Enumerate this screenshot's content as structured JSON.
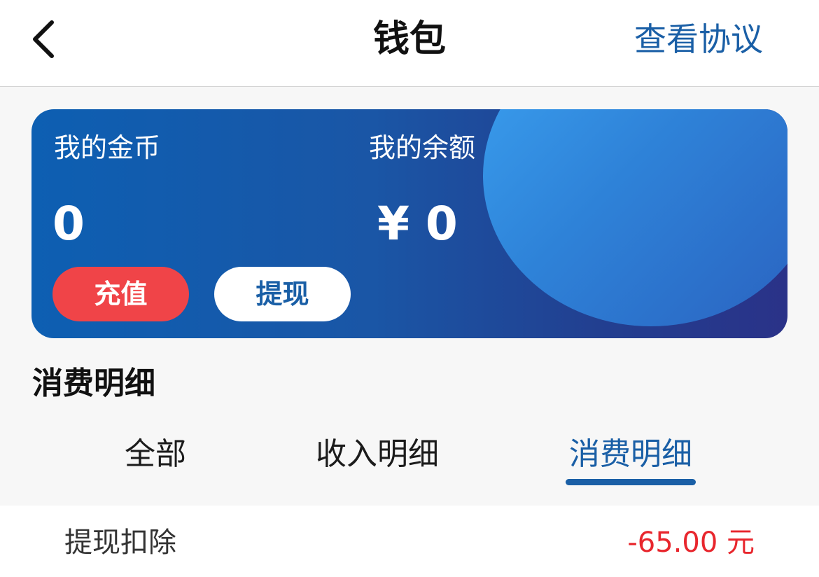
{
  "nav": {
    "back_icon": "chevron-left-icon",
    "title": "钱包",
    "agreement_link": "查看协议",
    "accent_color": "#1a5fa6"
  },
  "card": {
    "coins_label": "我的金币",
    "coins_value": "0",
    "balance_label": "我的余额",
    "balance_value": "¥ 0",
    "recharge_button": "充值",
    "withdraw_button": "提现",
    "recharge_color": "#f04448"
  },
  "section": {
    "title": "消费明细"
  },
  "tabs": [
    {
      "label": "全部",
      "active": false
    },
    {
      "label": "收入明细",
      "active": false
    },
    {
      "label": "消费明细",
      "active": true
    }
  ],
  "records": [
    {
      "name": "提现扣除",
      "amount": "-65.00 元",
      "amount_color": "#e8262d"
    }
  ]
}
